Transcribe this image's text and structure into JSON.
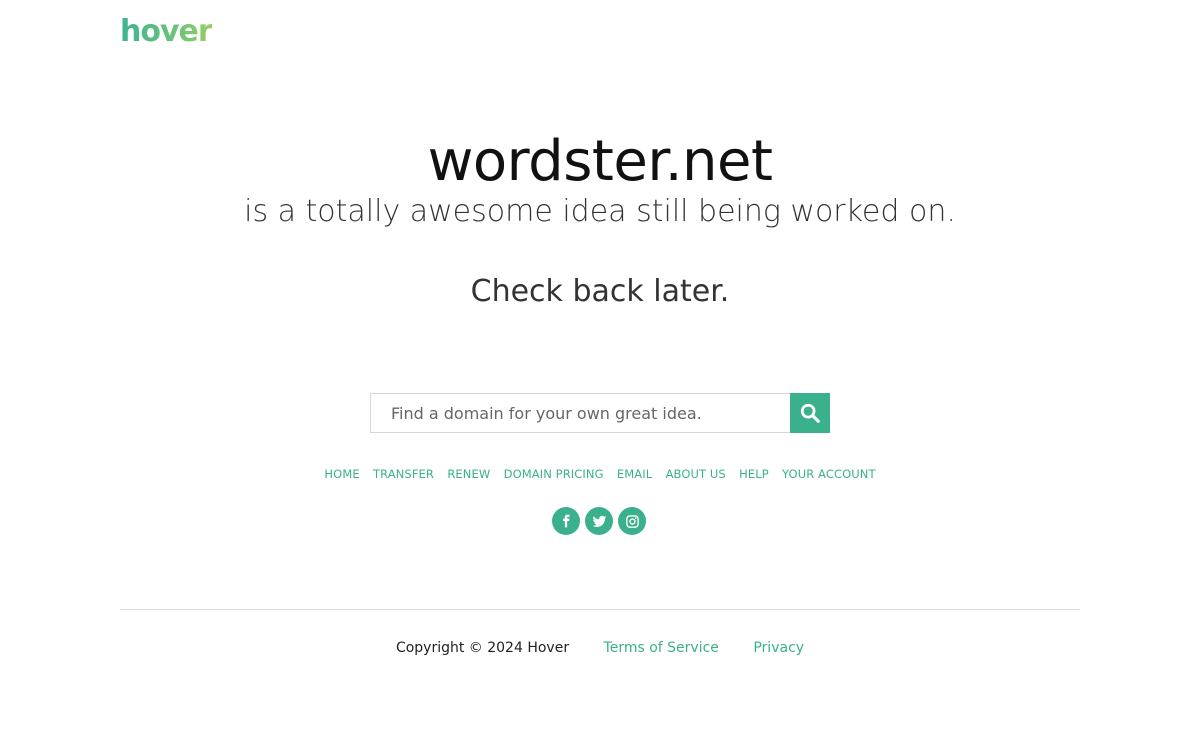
{
  "brand": {
    "logo_text": "hover",
    "accent_color": "#3ab08c"
  },
  "hero": {
    "domain": "wordster.net",
    "tagline": "is a totally awesome idea still being worked on.",
    "check_back": "Check back later."
  },
  "search": {
    "placeholder": "Find a domain for your own great idea.",
    "value": "",
    "button_icon": "search-icon"
  },
  "nav": {
    "items": [
      "HOME",
      "TRANSFER",
      "RENEW",
      "DOMAIN PRICING",
      "EMAIL",
      "ABOUT US",
      "HELP",
      "YOUR ACCOUNT"
    ]
  },
  "social": {
    "icons": [
      "facebook-icon",
      "twitter-icon",
      "instagram-icon"
    ]
  },
  "footer": {
    "copyright": "Copyright © 2024 Hover",
    "terms": "Terms of Service",
    "privacy": "Privacy"
  }
}
